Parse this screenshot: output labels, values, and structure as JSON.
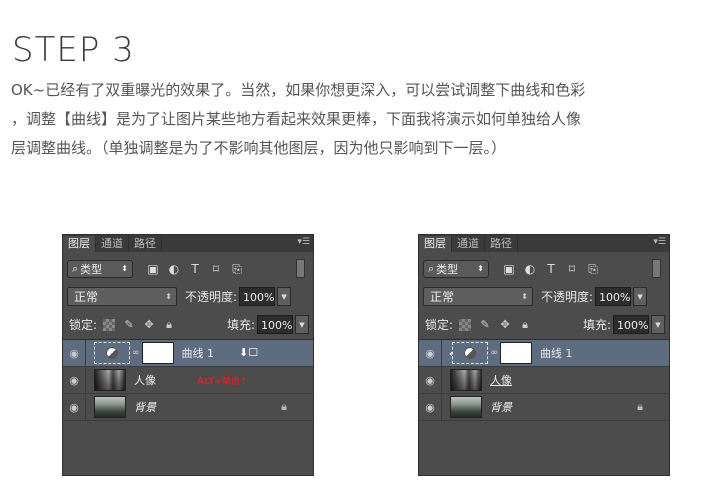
{
  "step_title": "STEP 3",
  "paragraph": {
    "line1": "OK~已经有了双重曝光的效果了。当然，如果你想更深入，可以尝试调整下曲线和色彩",
    "line2": "，调整【曲线】是为了让图片某些地方看起来效果更棒，下面我将演示如何单独给人像",
    "line3": "层调整曲线。（单独调整是为了不影响其他图层，因为他只影响到下一层。）"
  },
  "panels": [
    {
      "tabs": [
        "图层",
        "通道",
        "路径"
      ],
      "filter_label": "类型",
      "blend_mode": "正常",
      "opacity_label": "不透明度:",
      "opacity_value": "100%",
      "lock_label": "锁定:",
      "fill_label": "填充:",
      "fill_value": "100%",
      "layers": [
        {
          "name": "曲线 1",
          "annotation": "ALT+单击↑"
        },
        {
          "name": "人像"
        },
        {
          "name": "背景"
        }
      ]
    },
    {
      "tabs": [
        "图层",
        "通道",
        "路径"
      ],
      "filter_label": "类型",
      "blend_mode": "正常",
      "opacity_label": "不透明度:",
      "opacity_value": "100%",
      "lock_label": "锁定:",
      "fill_label": "填充:",
      "fill_value": "100%",
      "layers": [
        {
          "name": "曲线 1"
        },
        {
          "name": "人像"
        },
        {
          "name": "背景"
        }
      ]
    }
  ],
  "colors": {
    "panel_bg": "#4c4c4c",
    "selected_layer": "#5e6c80",
    "annotation_red": "#d9202a"
  },
  "icons": [
    "search-icon",
    "image-filter-icon",
    "adjustment-filter-icon",
    "type-filter-icon",
    "shape-filter-icon",
    "smart-object-filter-icon",
    "eye-icon",
    "link-icon",
    "lock-icon",
    "clipping-arrow-icon"
  ]
}
